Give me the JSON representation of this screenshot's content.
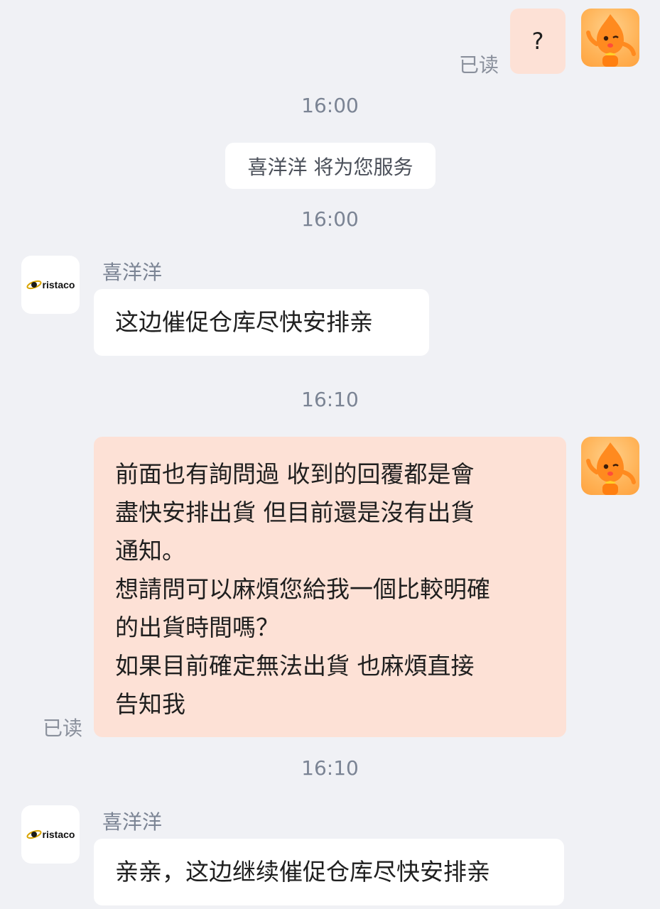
{
  "messages": [
    {
      "type": "outgoing",
      "text": "?",
      "status": "已读"
    },
    {
      "type": "timestamp",
      "text": "16:00"
    },
    {
      "type": "system",
      "text": "喜洋洋 将为您服务"
    },
    {
      "type": "timestamp",
      "text": "16:00"
    },
    {
      "type": "incoming",
      "sender": "喜洋洋",
      "text": "这边催促仓库尽快安排亲"
    },
    {
      "type": "timestamp",
      "text": "16:10"
    },
    {
      "type": "outgoing",
      "text": "前面也有詢問過 收到的回覆都是會\n盡快安排出貨 但目前還是沒有出貨\n通知。\n想請問可以麻煩您給我一個比較明確\n的出貨時間嗎？\n如果目前確定無法出貨 也麻煩直接\n告知我",
      "status": "已读"
    },
    {
      "type": "timestamp",
      "text": "16:10"
    },
    {
      "type": "incoming",
      "sender": "喜洋洋",
      "text": "亲亲，这边继续催促仓库尽快安排亲"
    }
  ],
  "shop": {
    "logo_text": "ristaco",
    "logo_initial": "O"
  },
  "colors": {
    "outgoing_bubble": "#fde1d6",
    "incoming_bubble": "#ffffff",
    "background": "#f0f1f5",
    "muted_text": "#7b8494"
  },
  "icons": {
    "user_avatar": "orange-mascot-avatar",
    "shop_avatar": "oristaco-logo"
  }
}
